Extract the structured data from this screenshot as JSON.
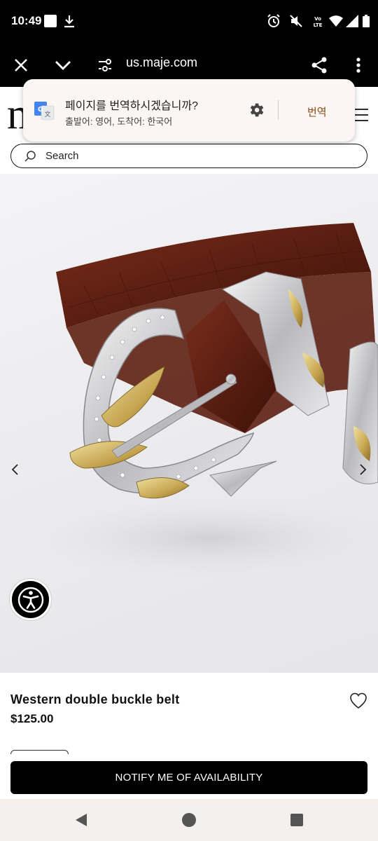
{
  "status_bar": {
    "time": "10:49",
    "icons": [
      "notification-square-icon",
      "download-icon",
      "alarm-icon",
      "mute-icon",
      "volte-icon",
      "wifi-icon",
      "signal-icon",
      "battery-icon"
    ],
    "volte_label": "VoLTE"
  },
  "browser": {
    "url": "us.maje.com",
    "icons": [
      "close-icon",
      "chevron-down-icon",
      "site-settings-icon",
      "share-icon",
      "more-vert-icon"
    ]
  },
  "translate_popup": {
    "title": "페이지를 번역하시겠습니까?",
    "subtitle": "출발어: 영어, 도착어: 한국어",
    "action_label": "번역",
    "icons": [
      "google-translate-icon",
      "gear-icon"
    ],
    "action_color": "#8a4a12"
  },
  "site": {
    "logo_fragment": "m",
    "search_placeholder": "Search",
    "icons": [
      "search-icon",
      "hamburger-menu-icon"
    ]
  },
  "product": {
    "name": "Western double buckle belt",
    "price": "$125.00",
    "notify_label": "NOTIFY ME OF AVAILABILITY",
    "icons": [
      "chevron-left-icon",
      "chevron-right-icon",
      "accessibility-icon",
      "heart-outline-icon"
    ],
    "image_subject": "brown croc-embossed leather belt with silver and gold western buckle"
  },
  "nav_bar": {
    "icons": [
      "back-triangle-icon",
      "home-circle-icon",
      "recents-square-icon"
    ]
  },
  "colors": {
    "status_bg": "#000000",
    "button_bg": "#000000",
    "popup_bg": "#fbf6f3",
    "nav_bg": "#f3f0ee"
  }
}
